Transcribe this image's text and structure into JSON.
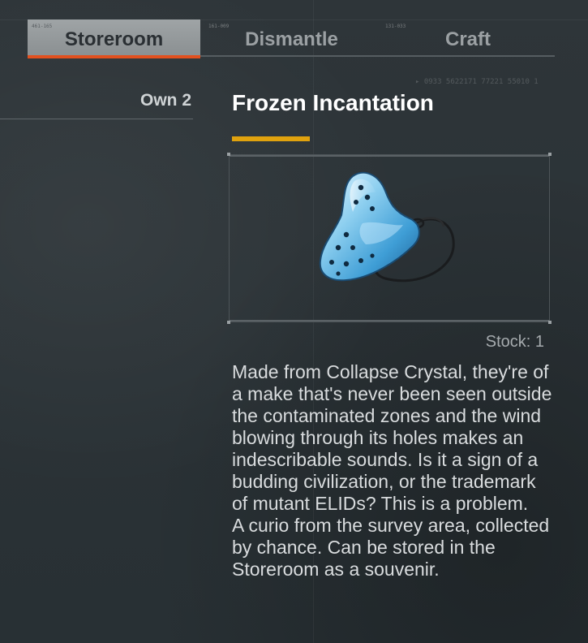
{
  "tabs": [
    {
      "label": "Storeroom",
      "code": "461-165",
      "active": true
    },
    {
      "label": "Dismantle",
      "code": "161-009",
      "active": false
    },
    {
      "label": "Craft",
      "code": "131-033",
      "active": false
    }
  ],
  "deco_code": "▸ 0933  5622171  77221  55010  1",
  "own": {
    "label": "Own 2"
  },
  "item": {
    "title": "Frozen Incantation",
    "image_icon": "ocarina-icon",
    "stock_label": "Stock: 1",
    "description": "Made from Collapse Crystal, they're of a make that's never been seen outside the contaminated zones and the wind blowing through its holes makes an indescribable sounds. Is it a sign of a budding civilization, or the trademark of mutant ELIDs? This is a problem.",
    "description_2": "A curio from the survey area, collected by chance. Can be stored in the Storeroom as a souvenir."
  },
  "colors": {
    "active_tab_bar": "#e2501e",
    "title_accent": "#e0a20e",
    "background": "#2b3236"
  }
}
